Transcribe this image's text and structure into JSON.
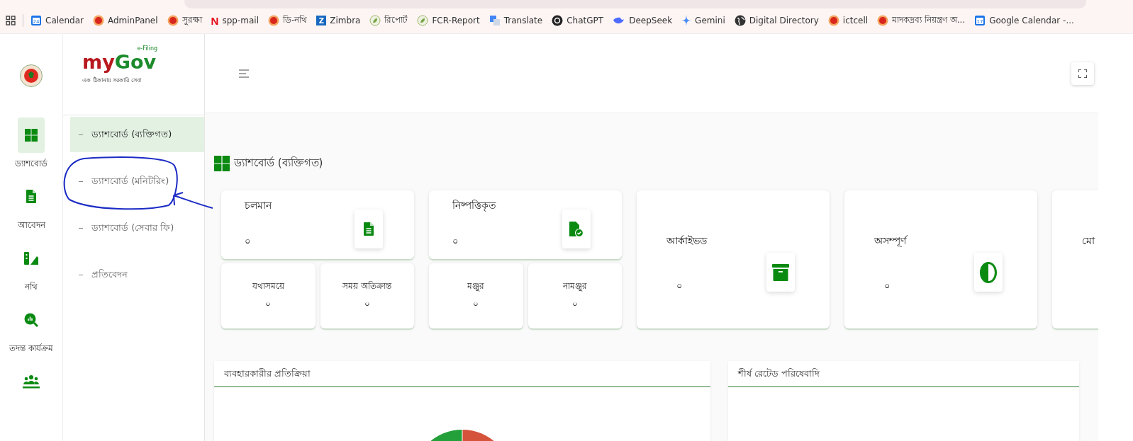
{
  "bookmarks": [
    {
      "label": "Calendar",
      "kind": "calendar",
      "icon_text": "24"
    },
    {
      "label": "AdminPanel",
      "kind": "emblem"
    },
    {
      "label": "সুরক্ষা",
      "kind": "emblem"
    },
    {
      "label": "spp-mail",
      "kind": "letter",
      "icon_text": "N"
    },
    {
      "label": "ডি-নথি",
      "kind": "emblem"
    },
    {
      "label": "Zimbra",
      "kind": "square-letter",
      "icon_text": "Z"
    },
    {
      "label": "রিপোর্ট",
      "kind": "leaf"
    },
    {
      "label": "FCR-Report",
      "kind": "leaf"
    },
    {
      "label": "Translate",
      "kind": "translate"
    },
    {
      "label": "ChatGPT",
      "kind": "knot"
    },
    {
      "label": "DeepSeek",
      "kind": "whale"
    },
    {
      "label": "Gemini",
      "kind": "sparkle"
    },
    {
      "label": "Digital Directory",
      "kind": "globe"
    },
    {
      "label": "ictcell",
      "kind": "emblem"
    },
    {
      "label": "মাদকদ্রব্য নিয়ন্ত্রণ অ...",
      "kind": "emblem"
    },
    {
      "label": "Google Calendar -...",
      "kind": "calendar",
      "icon_text": "17"
    }
  ],
  "rail": [
    {
      "label": "ড্যাশবোর্ড",
      "kind": "grid",
      "selected": true
    },
    {
      "label": "আবেদন",
      "kind": "document",
      "selected": false
    },
    {
      "label": "নথি",
      "kind": "files",
      "selected": false
    },
    {
      "label": "তদন্ত কার্যক্রম",
      "kind": "magnifier",
      "selected": false
    },
    {
      "kind": "people",
      "selected": false
    }
  ],
  "logo": {
    "my": "my",
    "gov": "Gov",
    "superscript": "e-Filing",
    "tagline": "এক ঠিকানায় সরকারি সেবা"
  },
  "sidebar": {
    "items": [
      {
        "label": "ড্যাশবোর্ড (ব্যক্তিগত)",
        "selected": true
      },
      {
        "label": "ড্যাশবোর্ড (মনিটরিং)",
        "selected": false
      },
      {
        "label": "ড্যাশবোর্ড (সেবার ফি)",
        "selected": false
      },
      {
        "label": "প্রতিবেদন",
        "selected": false
      }
    ]
  },
  "page_title": "ড্যাশবোর্ড (ব্যক্তিগত)",
  "cards": [
    {
      "kind": "split",
      "title": "চলমান",
      "value": "০",
      "subs": [
        {
          "title": "যথাসময়ে",
          "value": "০"
        },
        {
          "title": "সময় অতিক্রান্ত",
          "value": "০"
        }
      ]
    },
    {
      "kind": "split",
      "title": "নিষ্পত্তিকৃত",
      "value": "০",
      "subs": [
        {
          "title": "মঞ্জুর",
          "value": "০"
        },
        {
          "title": "নামঞ্জুর",
          "value": "০"
        }
      ]
    },
    {
      "kind": "single",
      "title": "আর্কাইভড",
      "value": "০"
    },
    {
      "kind": "single",
      "title": "অসম্পূর্ণ",
      "value": "০"
    },
    {
      "kind": "single",
      "title": "মো"
    }
  ],
  "panels": [
    {
      "title": "ব্যবহারকারীর প্রতিক্রিয়া"
    },
    {
      "title": "শীর্ষ রেটেড পরিষেবাদি"
    }
  ]
}
